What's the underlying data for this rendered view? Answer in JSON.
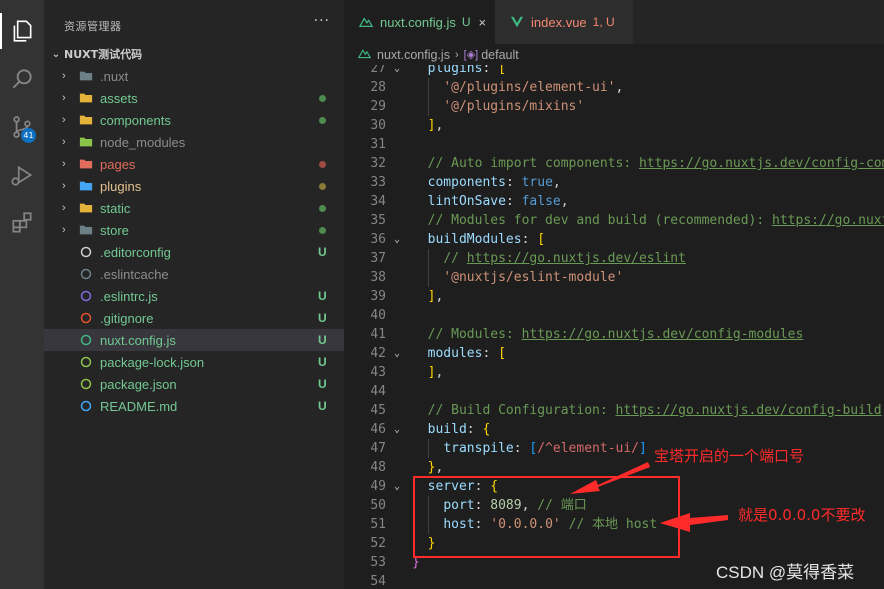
{
  "activity_bar": {
    "items": [
      "explorer-icon",
      "search-icon",
      "source-control-icon",
      "run-debug-icon",
      "extensions-icon"
    ],
    "source_control_badge": "41"
  },
  "sidebar": {
    "title": "资源管理器",
    "more": "···",
    "project": "NUXT测试代码",
    "items": [
      {
        "name": ".nuxt",
        "type": "folder",
        "color": "#8c8c8c",
        "icon_color": "#6d8086",
        "status": "",
        "dot": ""
      },
      {
        "name": "assets",
        "type": "folder",
        "color": "#73c991",
        "icon_color": "#e6b33a",
        "status": "",
        "dot": "#4f8a4f"
      },
      {
        "name": "components",
        "type": "folder",
        "color": "#73c991",
        "icon_color": "#e6b33a",
        "status": "",
        "dot": "#4f8a4f"
      },
      {
        "name": "node_modules",
        "type": "folder",
        "color": "#8c8c8c",
        "icon_color": "#8bc34a",
        "status": "",
        "dot": ""
      },
      {
        "name": "pages",
        "type": "folder",
        "color": "#e06c5c",
        "icon_color": "#e06c5c",
        "status": "",
        "dot": "#a14b45"
      },
      {
        "name": "plugins",
        "type": "folder",
        "color": "#e2c08d",
        "icon_color": "#42a5f5",
        "status": "",
        "dot": "#8a7a3a"
      },
      {
        "name": "static",
        "type": "folder",
        "color": "#73c991",
        "icon_color": "#e6b33a",
        "status": "",
        "dot": "#4f8a4f"
      },
      {
        "name": "store",
        "type": "folder",
        "color": "#73c991",
        "icon_color": "#6d8086",
        "status": "",
        "dot": "#4f8a4f"
      },
      {
        "name": ".editorconfig",
        "type": "file",
        "color": "#73c991",
        "icon_color": "#cccccc",
        "status": "U",
        "dot": ""
      },
      {
        "name": ".eslintcache",
        "type": "file",
        "color": "#8c8c8c",
        "icon_color": "#6d8086",
        "status": "",
        "dot": ""
      },
      {
        "name": ".eslintrc.js",
        "type": "file",
        "color": "#73c991",
        "icon_color": "#7b6fd6",
        "status": "U",
        "dot": ""
      },
      {
        "name": ".gitignore",
        "type": "file",
        "color": "#73c991",
        "icon_color": "#e0542a",
        "status": "U",
        "dot": ""
      },
      {
        "name": "nuxt.config.js",
        "type": "file",
        "color": "#73c991",
        "icon_color": "#41b883",
        "status": "U",
        "dot": ""
      },
      {
        "name": "package-lock.json",
        "type": "file",
        "color": "#73c991",
        "icon_color": "#8bc34a",
        "status": "U",
        "dot": ""
      },
      {
        "name": "package.json",
        "type": "file",
        "color": "#73c991",
        "icon_color": "#8bc34a",
        "status": "U",
        "dot": ""
      },
      {
        "name": "README.md",
        "type": "file",
        "color": "#73c991",
        "icon_color": "#42a5f5",
        "status": "U",
        "dot": ""
      }
    ]
  },
  "tabs": [
    {
      "label": "nuxt.config.js",
      "status": "U",
      "close": "×",
      "color": "#73c991"
    },
    {
      "label": "index.vue",
      "status": "1, U",
      "close": "",
      "color": "#f48771"
    }
  ],
  "breadcrumb": {
    "file": "nuxt.config.js",
    "separator": "›",
    "symbol": "default"
  },
  "code": {
    "line_numbers": [
      "27",
      "28",
      "29",
      "30",
      "31",
      "32",
      "33",
      "34",
      "35",
      "36",
      "37",
      "38",
      "39",
      "40",
      "41",
      "42",
      "43",
      "44",
      "45",
      "46",
      "47",
      "48",
      "49",
      "50",
      "51",
      "52",
      "53",
      "54"
    ],
    "lines": [
      [
        [
          "k",
          "plugins"
        ],
        [
          "pl",
          ": "
        ],
        [
          "br2",
          "["
        ]
      ],
      [
        [
          "pl",
          "  "
        ],
        [
          "s",
          "'@/plugins/element-ui'"
        ],
        [
          "pl",
          ","
        ]
      ],
      [
        [
          "pl",
          "  "
        ],
        [
          "s",
          "'@/plugins/mixins'"
        ]
      ],
      [
        [
          "br2",
          "]"
        ],
        [
          "pl",
          ","
        ]
      ],
      [],
      [
        [
          "cm",
          "// Auto import components: "
        ],
        [
          "cm-u",
          "https://go.nuxtjs.dev/config-components"
        ]
      ],
      [
        [
          "k",
          "components"
        ],
        [
          "pl",
          ": "
        ],
        [
          "kw",
          "true"
        ],
        [
          "pl",
          ","
        ]
      ],
      [
        [
          "k",
          "lintOnSave"
        ],
        [
          "pl",
          ": "
        ],
        [
          "kw",
          "false"
        ],
        [
          "pl",
          ","
        ]
      ],
      [
        [
          "cm",
          "// Modules for dev and build (recommended): "
        ],
        [
          "cm-u",
          "https://go.nuxtjs.dev/config-modules"
        ]
      ],
      [
        [
          "k",
          "buildModules"
        ],
        [
          "pl",
          ": "
        ],
        [
          "br2",
          "["
        ]
      ],
      [
        [
          "pl",
          "  "
        ],
        [
          "cm",
          "// "
        ],
        [
          "cm-u",
          "https://go.nuxtjs.dev/eslint"
        ]
      ],
      [
        [
          "pl",
          "  "
        ],
        [
          "s",
          "'@nuxtjs/eslint-module'"
        ]
      ],
      [
        [
          "br2",
          "]"
        ],
        [
          "pl",
          ","
        ]
      ],
      [],
      [
        [
          "cm",
          "// Modules: "
        ],
        [
          "cm-u",
          "https://go.nuxtjs.dev/config-modules"
        ]
      ],
      [
        [
          "k",
          "modules"
        ],
        [
          "pl",
          ": "
        ],
        [
          "br2",
          "["
        ]
      ],
      [
        [
          "br2",
          "]"
        ],
        [
          "pl",
          ","
        ]
      ],
      [],
      [
        [
          "cm",
          "// Build Configuration: "
        ],
        [
          "cm-u",
          "https://go.nuxtjs.dev/config-build"
        ]
      ],
      [
        [
          "k",
          "build"
        ],
        [
          "pl",
          ": "
        ],
        [
          "br2",
          "{"
        ]
      ],
      [
        [
          "pl",
          "  "
        ],
        [
          "k",
          "transpile"
        ],
        [
          "pl",
          ": "
        ],
        [
          "br3",
          "["
        ],
        [
          "rx",
          "/^element-ui/"
        ],
        [
          "br3",
          "]"
        ]
      ],
      [
        [
          "br2",
          "}"
        ],
        [
          "pl",
          ","
        ]
      ],
      [
        [
          "k",
          "server"
        ],
        [
          "pl",
          ": "
        ],
        [
          "br2",
          "{"
        ]
      ],
      [
        [
          "pl",
          "  "
        ],
        [
          "k",
          "port"
        ],
        [
          "pl",
          ": "
        ],
        [
          "num",
          "8089"
        ],
        [
          "pl",
          ", "
        ],
        [
          "cm",
          "// 端口"
        ]
      ],
      [
        [
          "pl",
          "  "
        ],
        [
          "k",
          "host"
        ],
        [
          "pl",
          ": "
        ],
        [
          "s",
          "'0.0.0.0'"
        ],
        [
          "pl",
          " "
        ],
        [
          "cm",
          "// 本地 host"
        ]
      ],
      [
        [
          "br2",
          "}"
        ]
      ],
      [
        [
          "br1",
          "}"
        ]
      ],
      []
    ]
  },
  "annotations": {
    "port_note": "宝塔开启的一个端口号",
    "host_note": "就是0.0.0.0不要改",
    "highlight_color": "#ff2a2a"
  },
  "watermark": "CSDN @莫得香菜"
}
